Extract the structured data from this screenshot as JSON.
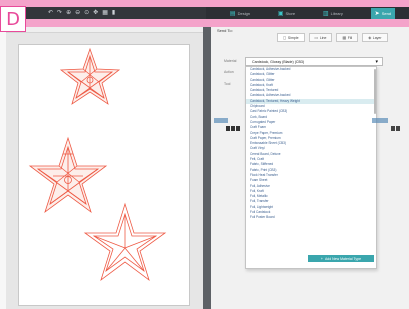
{
  "badge": {
    "letter": "D",
    "color": "#e84a9a"
  },
  "toolbar": {
    "icons": [
      "undo-icon",
      "redo-icon",
      "zoom-in-icon",
      "zoom-out-icon",
      "zoom-fit-icon",
      "pan-icon",
      "grid-icon",
      "trash-icon"
    ]
  },
  "tabs": [
    {
      "label": "Design",
      "icon": "design-icon",
      "active": false
    },
    {
      "label": "Store",
      "icon": "store-icon",
      "active": false
    },
    {
      "label": "Library",
      "icon": "library-icon",
      "active": false
    },
    {
      "label": "Send",
      "icon": "send-icon",
      "active": true
    }
  ],
  "panel": {
    "head_label": "Send To:",
    "row_tabs": [
      "Simple",
      "Line",
      "Fill",
      "Layer"
    ],
    "label_material": "Material",
    "label_action": "Action",
    "label_tool": "Tool",
    "selected_material": "Cardstock, Glossy (Blade) (CB3)",
    "materials": [
      "Cardstock, Adhesive-backed",
      "Cardstock, Glitter",
      "Cardstock, Glitter",
      "Cardstock, Kraft",
      "Cardstock, Textured",
      "Cardstock, Adhesive-backed",
      "Cardstock, Textured, Heavy Weight",
      "Chipboard",
      "Cast Fabric Painted (CB3)",
      "Cork, Board",
      "Corrugated Paper",
      "Craft Foam",
      "Crepe Paper, Premium",
      "Craft Paper, Premium",
      "Embossable Sheet (CB3)",
      "Craft Vinyl",
      "Cereal Board, Deluxe",
      "Felt, Craft",
      "Fabric, Stiffened",
      "Fabric, Print (CB3)",
      "Flock Heat Transfer",
      "Foam Sheet",
      "Foil, Adhesive",
      "Foil, Kraft",
      "Foil, Metallic",
      "Foil, Transfer",
      "Foil, Lightweight",
      "Foil Cardstock",
      "Foil Poster Board"
    ],
    "selected_index": 6,
    "add_button_label": "Add New Material Type"
  }
}
